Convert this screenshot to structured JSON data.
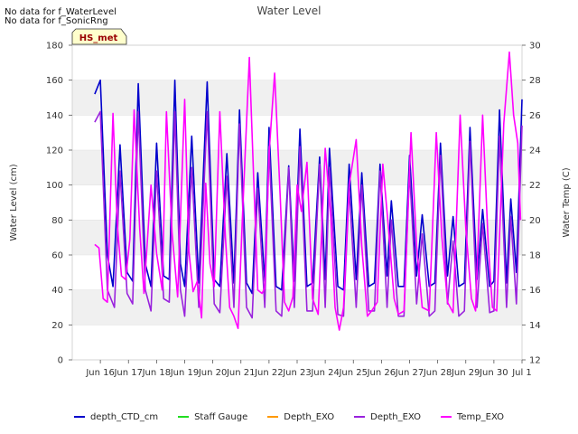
{
  "notices": [
    "No data for f_WaterLevel",
    "No data for f_SonicRng"
  ],
  "station_label": "HS_met",
  "chart_data": {
    "type": "line",
    "title": "Water Level",
    "ylabel": "Water Level (cm)",
    "y2label": "Water Temp (C)",
    "x_ticks": [
      "Jun 16",
      "Jun 17",
      "Jun 18",
      "Jun 19",
      "Jun 20",
      "Jun 21",
      "Jun 22",
      "Jun 23",
      "Jun 24",
      "Jun 25",
      "Jun 26",
      "Jun 27",
      "Jun 28",
      "Jun 29",
      "Jun 30",
      "Jul 1"
    ],
    "x_tick_labels": [
      "Jun 16",
      "Jun 17",
      "Jun 18",
      "Jun 19",
      "Jun 20",
      "Jun 21",
      "Jun 22",
      "Jun 23",
      "Jun 24",
      "Jun 25",
      "Jun 26",
      "Jun 27",
      "Jun 28",
      "Jun 29",
      "Jun 30",
      "Jul 1"
    ],
    "xlim": [
      "Jun 15",
      "Jul 1"
    ],
    "ylim": [
      0,
      180
    ],
    "y_ticks": [
      0,
      20,
      40,
      60,
      80,
      100,
      120,
      140,
      160,
      180
    ],
    "y2lim": [
      12,
      30
    ],
    "y2_ticks": [
      12,
      14,
      16,
      18,
      20,
      22,
      24,
      26,
      28,
      30
    ],
    "grid": "horizontal bands",
    "legend": "bottom",
    "series": [
      {
        "name": "depth_CTD_cm",
        "axis": "left",
        "color": "#0000cc",
        "points": [
          [
            "Jun 15.8",
            152
          ],
          [
            "Jun 16.0",
            160
          ],
          [
            "Jun 16.25",
            60
          ],
          [
            "Jun 16.45",
            42
          ],
          [
            "Jun 16.7",
            123
          ],
          [
            "Jun 16.95",
            50
          ],
          [
            "Jun 17.15",
            45
          ],
          [
            "Jun 17.35",
            158
          ],
          [
            "Jun 17.6",
            55
          ],
          [
            "Jun 17.8",
            42
          ],
          [
            "Jun 18.0",
            124
          ],
          [
            "Jun 18.25",
            48
          ],
          [
            "Jun 18.45",
            46
          ],
          [
            "Jun 18.65",
            160
          ],
          [
            "Jun 18.85",
            55
          ],
          [
            "Jun 19.0",
            42
          ],
          [
            "Jun 19.25",
            128
          ],
          [
            "Jun 19.5",
            44
          ],
          [
            "Jun 19.8",
            159
          ],
          [
            "Jun 20.05",
            46
          ],
          [
            "Jun 20.25",
            42
          ],
          [
            "Jun 20.5",
            118
          ],
          [
            "Jun 20.75",
            44
          ],
          [
            "Jun 20.95",
            143
          ],
          [
            "Jun 21.2",
            44
          ],
          [
            "Jun 21.4",
            38
          ],
          [
            "Jun 21.6",
            107
          ],
          [
            "Jun 21.85",
            45
          ],
          [
            "Jun 22.0",
            133
          ],
          [
            "Jun 22.25",
            42
          ],
          [
            "Jun 22.45",
            40
          ],
          [
            "Jun 22.7",
            111
          ],
          [
            "Jun 22.9",
            45
          ],
          [
            "Jun 23.1",
            132
          ],
          [
            "Jun 23.35",
            42
          ],
          [
            "Jun 23.55",
            44
          ],
          [
            "Jun 23.8",
            116
          ],
          [
            "Jun 24.0",
            46
          ],
          [
            "Jun 24.15",
            121
          ],
          [
            "Jun 24.45",
            42
          ],
          [
            "Jun 24.65",
            40
          ],
          [
            "Jun 24.85",
            112
          ],
          [
            "Jun 25.1",
            46
          ],
          [
            "Jun 25.3",
            107
          ],
          [
            "Jun 25.55",
            42
          ],
          [
            "Jun 25.75",
            44
          ],
          [
            "Jun 25.95",
            112
          ],
          [
            "Jun 26.2",
            48
          ],
          [
            "Jun 26.35",
            91
          ],
          [
            "Jun 26.6",
            42
          ],
          [
            "Jun 26.8",
            42
          ],
          [
            "Jun 27.0",
            117
          ],
          [
            "Jun 27.25",
            48
          ],
          [
            "Jun 27.45",
            83
          ],
          [
            "Jun 27.7",
            42
          ],
          [
            "Jun 27.9",
            44
          ],
          [
            "Jun 28.1",
            124
          ],
          [
            "Jun 28.35",
            48
          ],
          [
            "Jun 28.55",
            82
          ],
          [
            "Jun 28.75",
            42
          ],
          [
            "Jun 28.95",
            44
          ],
          [
            "Jun 29.15",
            133
          ],
          [
            "Jun 29.4",
            46
          ],
          [
            "Jun 29.6",
            86
          ],
          [
            "Jun 29.85",
            42
          ],
          [
            "Jun 30.0",
            45
          ],
          [
            "Jun 30.2",
            143
          ],
          [
            "Jun 30.45",
            44
          ],
          [
            "Jun 30.6",
            92
          ],
          [
            "Jun 30.8",
            50
          ],
          [
            "Jun 31.0",
            149
          ]
        ]
      },
      {
        "name": "Staff Gauge",
        "axis": "left",
        "color": "#22dd22",
        "points": []
      },
      {
        "name": "Depth_EXO",
        "axis": "left",
        "color": "#ff9900",
        "points": []
      },
      {
        "name": "Depth_EXO",
        "axis": "left",
        "color": "#9922dd",
        "points": [
          [
            "Jun 15.8",
            136
          ],
          [
            "Jun 16.0",
            142
          ],
          [
            "Jun 16.25",
            40
          ],
          [
            "Jun 16.5",
            30
          ],
          [
            "Jun 16.7",
            108
          ],
          [
            "Jun 16.95",
            38
          ],
          [
            "Jun 17.15",
            32
          ],
          [
            "Jun 17.35",
            142
          ],
          [
            "Jun 17.6",
            40
          ],
          [
            "Jun 17.8",
            28
          ],
          [
            "Jun 18.0",
            108
          ],
          [
            "Jun 18.25",
            35
          ],
          [
            "Jun 18.45",
            33
          ],
          [
            "Jun 18.65",
            142
          ],
          [
            "Jun 18.85",
            40
          ],
          [
            "Jun 19.0",
            25
          ],
          [
            "Jun 19.25",
            110
          ],
          [
            "Jun 19.5",
            30
          ],
          [
            "Jun 19.8",
            142
          ],
          [
            "Jun 20.05",
            32
          ],
          [
            "Jun 20.25",
            27
          ],
          [
            "Jun 20.5",
            105
          ],
          [
            "Jun 20.75",
            30
          ],
          [
            "Jun 20.95",
            135
          ],
          [
            "Jun 21.2",
            30
          ],
          [
            "Jun 21.4",
            24
          ],
          [
            "Jun 21.6",
            98
          ],
          [
            "Jun 21.85",
            30
          ],
          [
            "Jun 22.0",
            122
          ],
          [
            "Jun 22.25",
            28
          ],
          [
            "Jun 22.45",
            25
          ],
          [
            "Jun 22.7",
            110
          ],
          [
            "Jun 22.9",
            30
          ],
          [
            "Jun 23.1",
            122
          ],
          [
            "Jun 23.35",
            28
          ],
          [
            "Jun 23.55",
            28
          ],
          [
            "Jun 23.8",
            112
          ],
          [
            "Jun 24.0",
            30
          ],
          [
            "Jun 24.15",
            110
          ],
          [
            "Jun 24.45",
            26
          ],
          [
            "Jun 24.65",
            25
          ],
          [
            "Jun 24.85",
            98
          ],
          [
            "Jun 25.1",
            30
          ],
          [
            "Jun 25.3",
            100
          ],
          [
            "Jun 25.55",
            28
          ],
          [
            "Jun 25.75",
            28
          ],
          [
            "Jun 25.95",
            108
          ],
          [
            "Jun 26.2",
            30
          ],
          [
            "Jun 26.35",
            80
          ],
          [
            "Jun 26.6",
            25
          ],
          [
            "Jun 26.8",
            25
          ],
          [
            "Jun 27.0",
            108
          ],
          [
            "Jun 27.25",
            32
          ],
          [
            "Jun 27.45",
            72
          ],
          [
            "Jun 27.7",
            25
          ],
          [
            "Jun 27.9",
            28
          ],
          [
            "Jun 28.1",
            117
          ],
          [
            "Jun 28.35",
            32
          ],
          [
            "Jun 28.55",
            68
          ],
          [
            "Jun 28.75",
            25
          ],
          [
            "Jun 28.95",
            28
          ],
          [
            "Jun 29.15",
            125
          ],
          [
            "Jun 29.4",
            30
          ],
          [
            "Jun 29.6",
            78
          ],
          [
            "Jun 29.85",
            27
          ],
          [
            "Jun 30.0",
            28
          ],
          [
            "Jun 30.2",
            128
          ],
          [
            "Jun 30.45",
            30
          ],
          [
            "Jun 30.6",
            82
          ],
          [
            "Jun 30.8",
            32
          ],
          [
            "Jun 31.0",
            134
          ]
        ]
      },
      {
        "name": "Temp_EXO",
        "axis": "right",
        "color": "#ff00ff",
        "points": [
          [
            "Jun 15.8",
            18.6
          ],
          [
            "Jun 15.95",
            18.4
          ],
          [
            "Jun 16.1",
            15.5
          ],
          [
            "Jun 16.25",
            15.3
          ],
          [
            "Jun 16.45",
            26.1
          ],
          [
            "Jun 16.6",
            19.8
          ],
          [
            "Jun 16.75",
            16.8
          ],
          [
            "Jun 16.9",
            16.6
          ],
          [
            "Jun 17.05",
            18.9
          ],
          [
            "Jun 17.2",
            26.3
          ],
          [
            "Jun 17.4",
            19.5
          ],
          [
            "Jun 17.55",
            15.8
          ],
          [
            "Jun 17.8",
            22.0
          ],
          [
            "Jun 18.0",
            18.1
          ],
          [
            "Jun 18.2",
            16.0
          ],
          [
            "Jun 18.35",
            26.2
          ],
          [
            "Jun 18.55",
            19.3
          ],
          [
            "Jun 18.75",
            15.6
          ],
          [
            "Jun 19.0",
            26.9
          ],
          [
            "Jun 19.15",
            18.2
          ],
          [
            "Jun 19.3",
            15.9
          ],
          [
            "Jun 19.45",
            16.5
          ],
          [
            "Jun 19.6",
            14.4
          ],
          [
            "Jun 19.75",
            22.1
          ],
          [
            "Jun 19.9",
            17.5
          ],
          [
            "Jun 20.05",
            16.2
          ],
          [
            "Jun 20.25",
            26.2
          ],
          [
            "Jun 20.45",
            19.0
          ],
          [
            "Jun 20.6",
            15.0
          ],
          [
            "Jun 20.75",
            14.5
          ],
          [
            "Jun 20.9",
            13.8
          ],
          [
            "Jun 21.05",
            20.0
          ],
          [
            "Jun 21.3",
            29.3
          ],
          [
            "Jun 21.45",
            22.5
          ],
          [
            "Jun 21.6",
            16.0
          ],
          [
            "Jun 21.75",
            15.8
          ],
          [
            "Jun 21.85",
            16.1
          ],
          [
            "Jun 22.0",
            23.8
          ],
          [
            "Jun 22.2",
            28.4
          ],
          [
            "Jun 22.4",
            21.3
          ],
          [
            "Jun 22.55",
            15.3
          ],
          [
            "Jun 22.7",
            14.8
          ],
          [
            "Jun 22.85",
            15.6
          ],
          [
            "Jun 23.0",
            22.0
          ],
          [
            "Jun 23.15",
            20.5
          ],
          [
            "Jun 23.35",
            23.3
          ],
          [
            "Jun 23.55",
            15.5
          ],
          [
            "Jun 23.75",
            14.6
          ],
          [
            "Jun 24.0",
            24.1
          ],
          [
            "Jun 24.2",
            20.2
          ],
          [
            "Jun 24.35",
            15.0
          ],
          [
            "Jun 24.5",
            13.7
          ],
          [
            "Jun 24.65",
            15.0
          ],
          [
            "Jun 24.85",
            22.0
          ],
          [
            "Jun 25.1",
            24.6
          ],
          [
            "Jun 25.3",
            18.5
          ],
          [
            "Jun 25.5",
            14.5
          ],
          [
            "Jun 25.65",
            14.8
          ],
          [
            "Jun 25.85",
            15.3
          ],
          [
            "Jun 26.05",
            23.2
          ],
          [
            "Jun 26.25",
            19.5
          ],
          [
            "Jun 26.45",
            15.5
          ],
          [
            "Jun 26.6",
            14.6
          ],
          [
            "Jun 26.8",
            14.8
          ],
          [
            "Jun 27.05",
            25.0
          ],
          [
            "Jun 27.25",
            18.5
          ],
          [
            "Jun 27.45",
            15.0
          ],
          [
            "Jun 27.7",
            14.8
          ],
          [
            "Jun 27.95",
            25.0
          ],
          [
            "Jun 28.15",
            19.0
          ],
          [
            "Jun 28.35",
            15.3
          ],
          [
            "Jun 28.55",
            14.7
          ],
          [
            "Jun 28.8",
            26.0
          ],
          [
            "Jun 29.0",
            19.5
          ],
          [
            "Jun 29.2",
            15.5
          ],
          [
            "Jun 29.35",
            14.8
          ],
          [
            "Jun 29.6",
            26.0
          ],
          [
            "Jun 29.8",
            18.5
          ],
          [
            "Jun 29.95",
            15.0
          ],
          [
            "Jun 30.1",
            14.8
          ],
          [
            "Jun 30.35",
            25.5
          ],
          [
            "Jun 30.55",
            29.6
          ],
          [
            "Jun 30.7",
            26.0
          ],
          [
            "Jun 30.85",
            24.4
          ],
          [
            "Jun 30.95",
            20.0
          ]
        ]
      }
    ]
  }
}
